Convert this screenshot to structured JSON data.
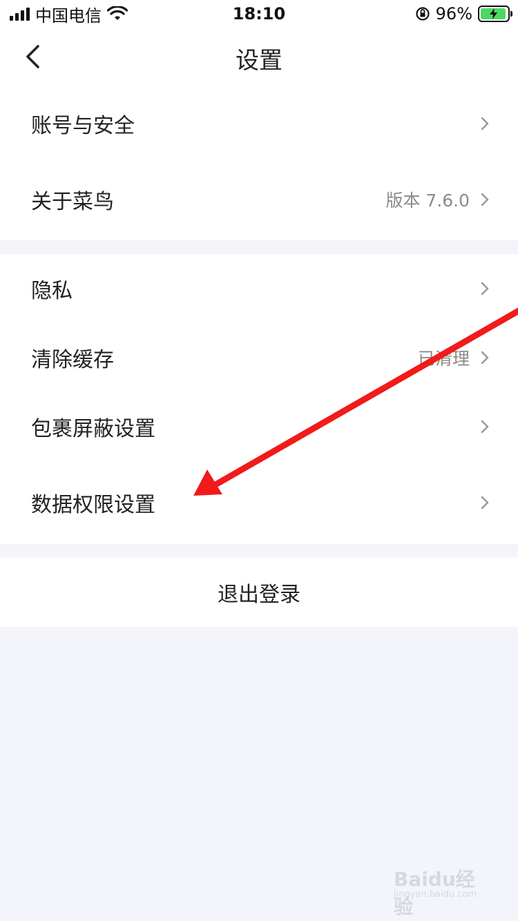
{
  "status_bar": {
    "carrier": "中国电信",
    "time": "18:10",
    "battery_text": "96%",
    "battery_level": 0.96
  },
  "nav": {
    "title": "设置"
  },
  "groups": {
    "account": {
      "items": [
        {
          "label": "账号与安全",
          "value": ""
        },
        {
          "label": "关于菜鸟",
          "value": "版本 7.6.0"
        }
      ]
    },
    "general": {
      "items": [
        {
          "label": "隐私",
          "value": ""
        },
        {
          "label": "清除缓存",
          "value": "已清理"
        },
        {
          "label": "包裹屏蔽设置",
          "value": ""
        },
        {
          "label": "数据权限设置",
          "value": ""
        }
      ]
    }
  },
  "logout": {
    "label": "退出登录"
  },
  "annotation": {
    "arrow_color": "#f21a1a"
  },
  "watermark": {
    "brand": "Baidu经验",
    "domain": "jingyan.baidu.com"
  },
  "colors": {
    "background": "#f3f5fa",
    "text_primary": "#222222",
    "text_secondary": "#8a8a8a",
    "battery_green": "#4cd964"
  }
}
